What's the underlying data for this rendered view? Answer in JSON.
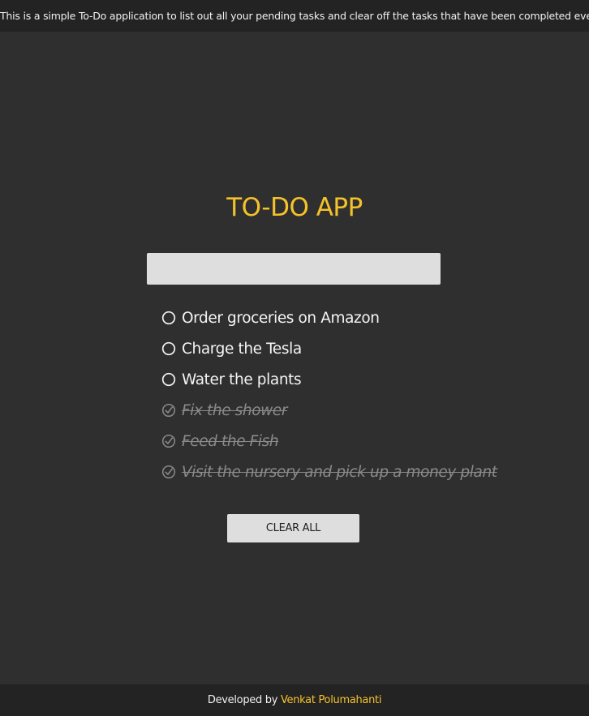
{
  "banner": {
    "text": "This is a simple To-Do application to list out all your pending tasks and clear off the tasks that have been completed eventually."
  },
  "app": {
    "title": "TO-DO APP"
  },
  "task_input": {
    "value": "",
    "placeholder": ""
  },
  "tasks": [
    {
      "label": "Order groceries on Amazon",
      "completed": false,
      "icon": "circle-icon"
    },
    {
      "label": "Charge the Tesla",
      "completed": false,
      "icon": "circle-icon"
    },
    {
      "label": "Water the plants",
      "completed": false,
      "icon": "circle-icon"
    },
    {
      "label": "Fix the shower",
      "completed": true,
      "icon": "check-circle-icon"
    },
    {
      "label": "Feed the Fish",
      "completed": true,
      "icon": "check-circle-icon"
    },
    {
      "label": "Visit the nursery and pick up a money plant",
      "completed": true,
      "icon": "check-circle-icon"
    }
  ],
  "clear_button": {
    "label": "CLEAR ALL"
  },
  "footer": {
    "prefix": "Developed by",
    "author": "Venkat Polumahanti"
  },
  "colors": {
    "background": "#2f2f2f",
    "bar": "#232323",
    "accent": "#f5c22b",
    "control": "#dedede",
    "done_text": "#8a8a8a"
  }
}
